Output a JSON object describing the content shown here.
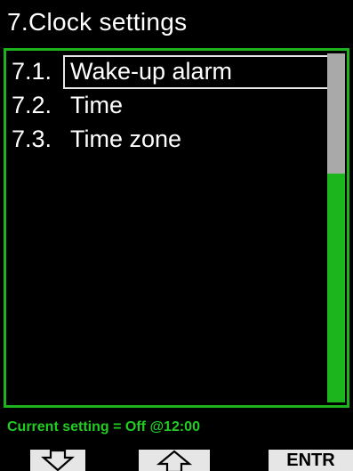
{
  "header": {
    "title": "7.Clock settings"
  },
  "menu": {
    "items": [
      {
        "number": "7.1.",
        "label": "Wake-up alarm",
        "selected": true
      },
      {
        "number": "7.2.",
        "label": "Time",
        "selected": false
      },
      {
        "number": "7.3.",
        "label": "Time zone",
        "selected": false
      }
    ]
  },
  "status": {
    "text": "Current setting = Off @12:00"
  },
  "softkeys": {
    "left_icon": "arrow-down-icon",
    "middle_icon": "arrow-up-icon",
    "right_label": "ENTR"
  },
  "colors": {
    "accent_green": "#1fb21f",
    "scrollbar_thumb": "#a9a9a9",
    "softkey_bg": "#e6e6e6"
  }
}
